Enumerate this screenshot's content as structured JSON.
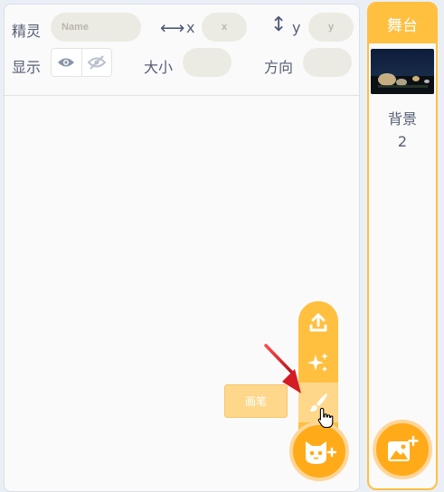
{
  "sprite_info": {
    "sprite_label": "精灵",
    "name_placeholder": "Name",
    "x_label": "x",
    "x_placeholder": "x",
    "y_label": "y",
    "y_placeholder": "y",
    "show_label": "显示",
    "size_label": "大小",
    "direction_label": "方向"
  },
  "stage": {
    "header": "舞台",
    "backdrops_label": "背景",
    "backdrops_count": "2"
  },
  "sprite_menu": {
    "tooltip": "画笔",
    "items": [
      "upload-sprite",
      "surprise",
      "paint"
    ]
  },
  "colors": {
    "accent": "#ffab19",
    "menu": "#ffbf3f",
    "tooltip": "#ffd78a",
    "annotation_arrow": "#e0242a"
  }
}
